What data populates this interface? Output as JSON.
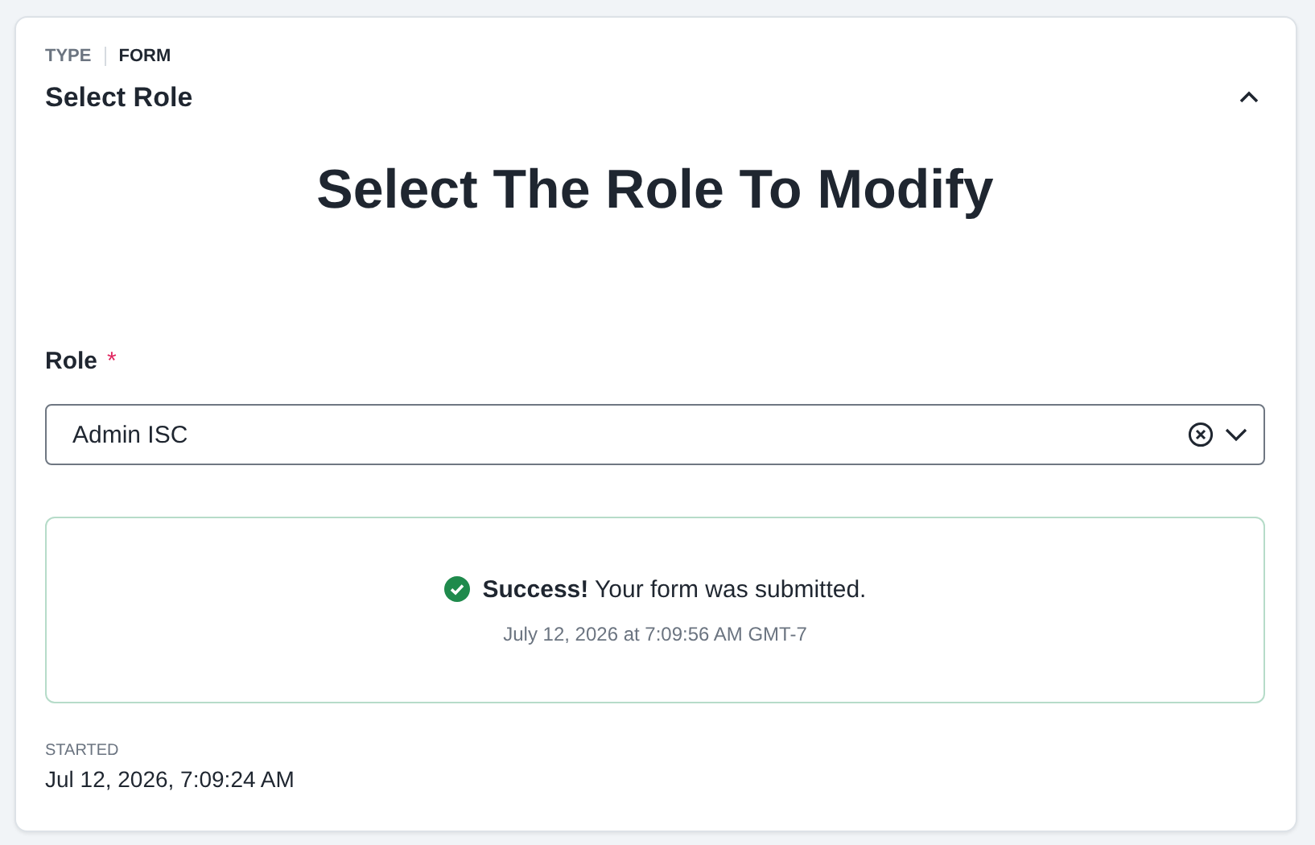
{
  "card": {
    "type_label": "TYPE",
    "type_value": "FORM",
    "title": "Select Role",
    "expanded": true
  },
  "form": {
    "heading": "Select The Role To Modify",
    "field": {
      "label": "Role",
      "required": true,
      "required_mark": "*",
      "value": "Admin ISC"
    },
    "alert": {
      "message": "**Success!** Your form was submitted.",
      "timestamp": "July 12, 2026 at 7:09:56 AM GMT-7"
    }
  },
  "started": {
    "label": "STARTED",
    "value": "Jul 12, 2026, 7:09:24 AM"
  }
}
